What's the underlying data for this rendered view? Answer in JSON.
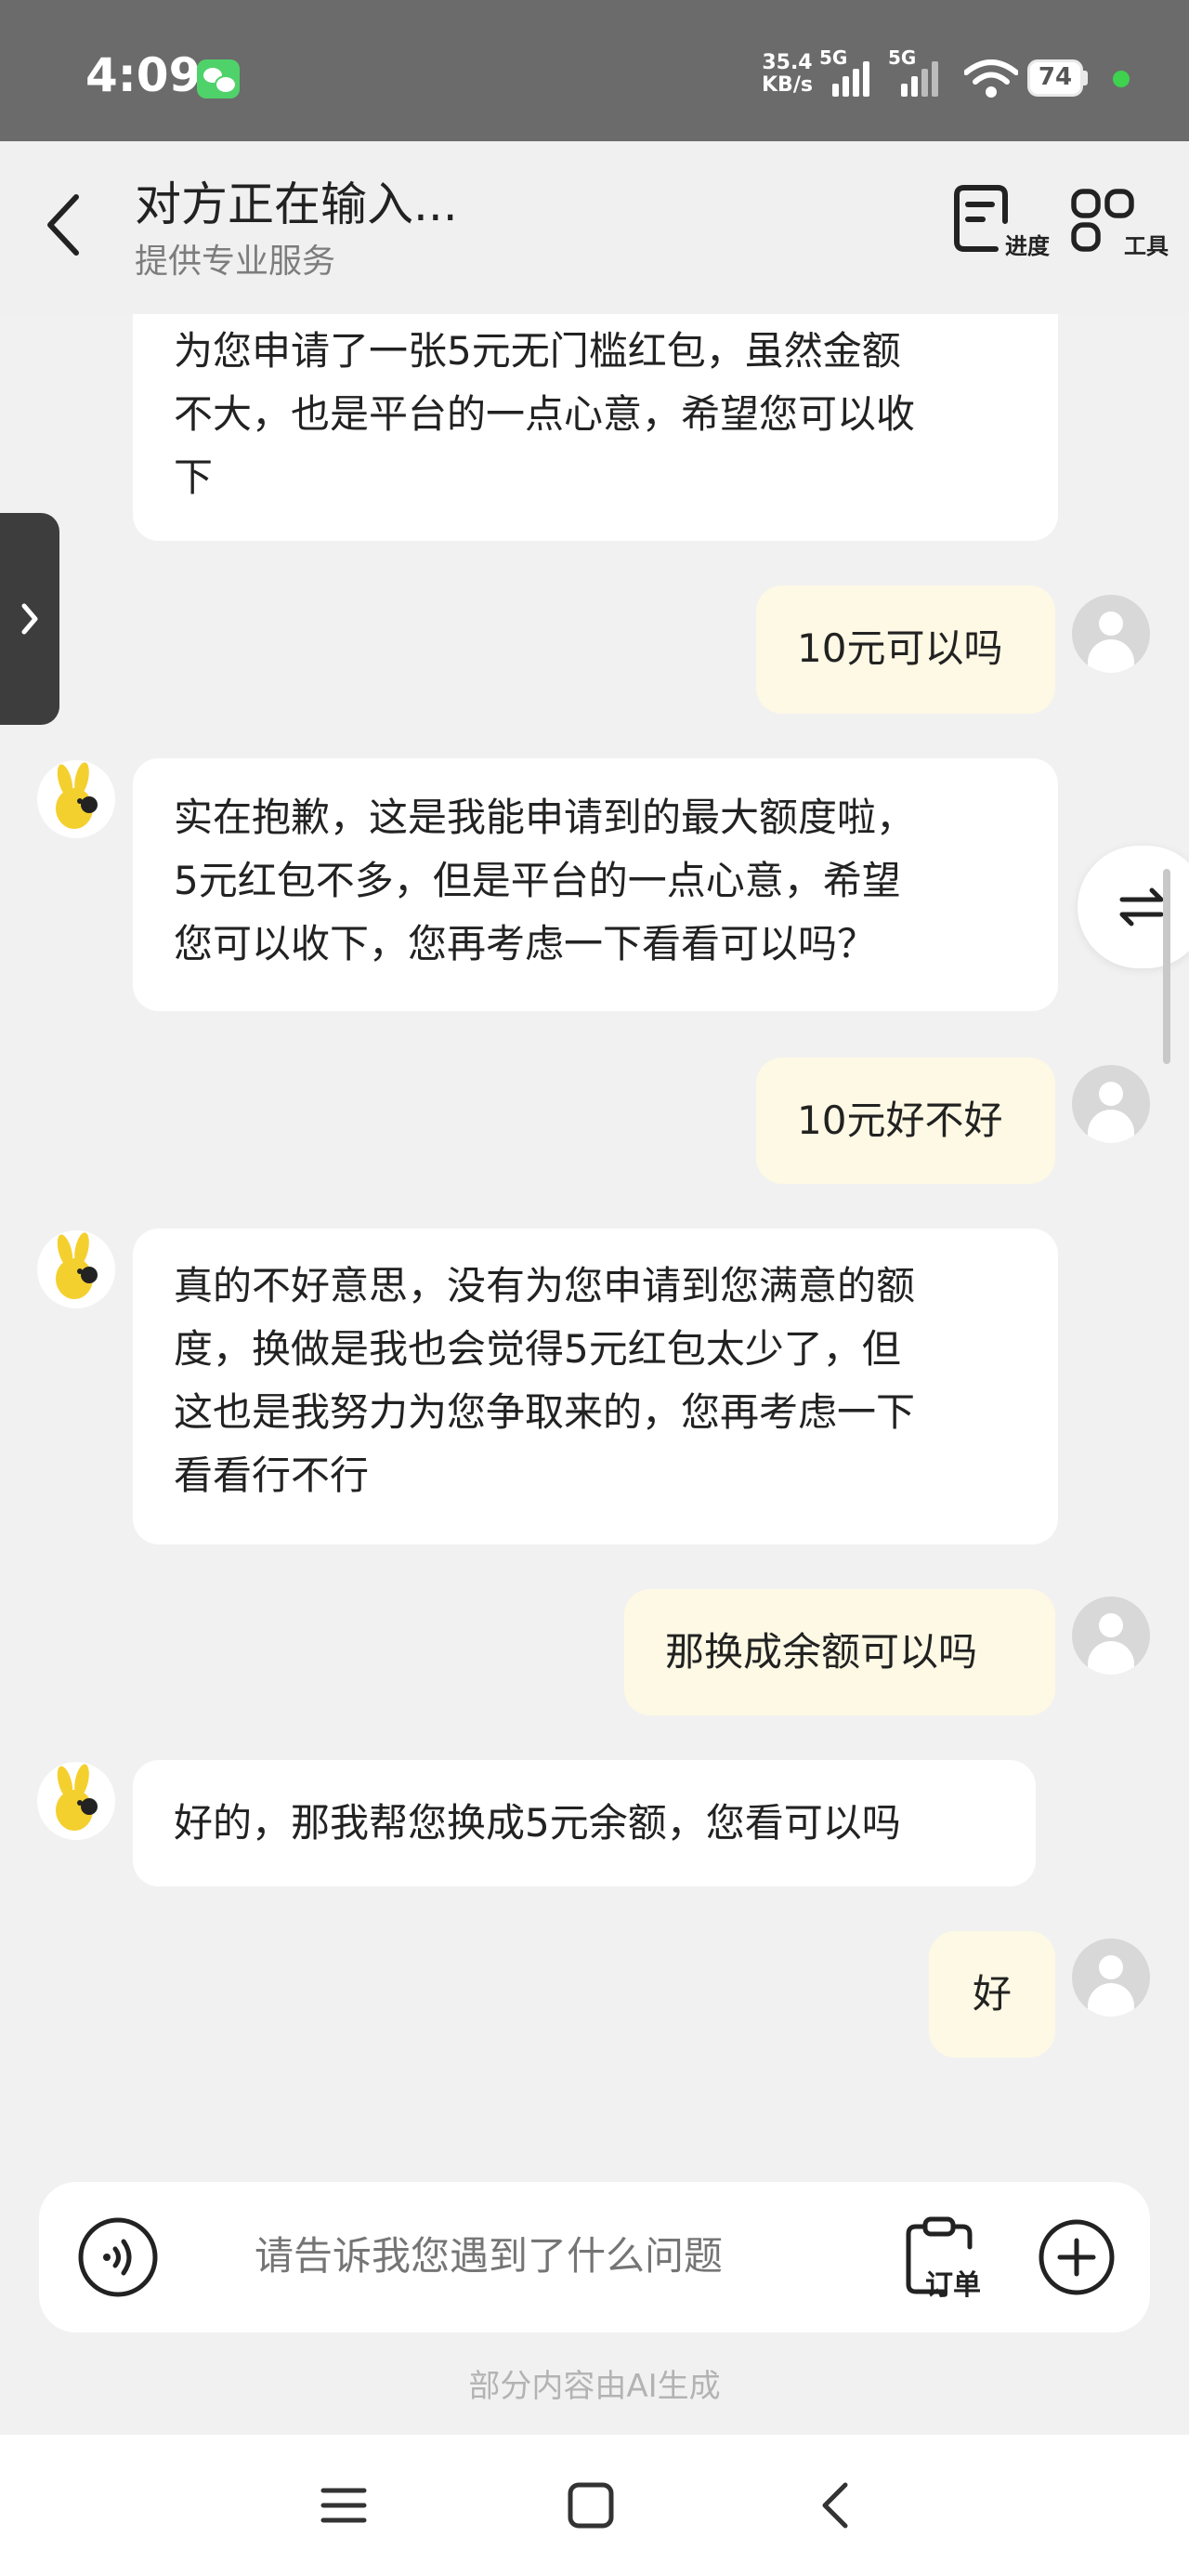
{
  "status_bar": {
    "time": "4:09",
    "net_speed_value": "35.4",
    "net_speed_unit": "KB/s",
    "signal_1_label": "5G",
    "signal_2_label": "5G",
    "battery": "74"
  },
  "header": {
    "title": "对方正在输入...",
    "subtitle": "提供专业服务",
    "progress_label": "进度",
    "tools_label": "工具"
  },
  "messages": [
    {
      "from": "bot",
      "text_lines": [
        "为您申请了一张5元无门槛红包，虽然金额",
        "不大，也是平台的一点心意，希望您可以收",
        "下"
      ]
    },
    {
      "from": "me",
      "text": "10元可以吗"
    },
    {
      "from": "bot",
      "text_lines": [
        "实在抱歉，这是我能申请到的最大额度啦，",
        "5元红包不多，但是平台的一点心意，希望",
        "您可以收下，您再考虑一下看看可以吗？"
      ]
    },
    {
      "from": "me",
      "text": "10元好不好"
    },
    {
      "from": "bot",
      "text_lines": [
        "真的不好意思，没有为您申请到您满意的额",
        "度，换做是我也会觉得5元红包太少了，但",
        "这也是我努力为您争取来的，您再考虑一下",
        "看看行不行"
      ]
    },
    {
      "from": "me",
      "text": "那换成余额可以吗"
    },
    {
      "from": "bot",
      "text_lines": [
        "好的，那我帮您换成5元余额，您看可以吗"
      ]
    },
    {
      "from": "me",
      "text": "好"
    }
  ],
  "input": {
    "placeholder": "请告诉我您遇到了什么问题",
    "order_label": "订单"
  },
  "footer_note": "部分内容由AI生成"
}
